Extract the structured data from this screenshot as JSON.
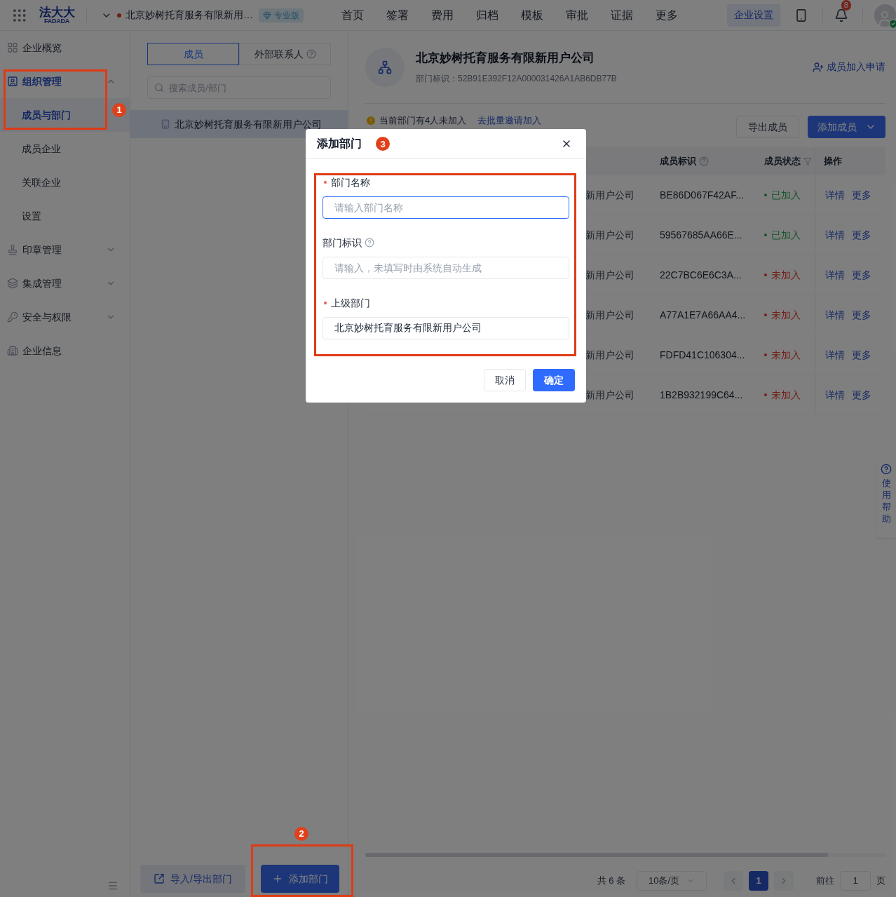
{
  "top_bar": {
    "logo_text": "法大大",
    "logo_subtext": "FADADA",
    "company": "北京妙树托育服务有限新用…",
    "edition": "专业版",
    "settings_button": "企业设置",
    "notification_count": "8",
    "nav": [
      {
        "label": "首页",
        "selected": false
      },
      {
        "label": "签署",
        "selected": false
      },
      {
        "label": "费用",
        "selected": false
      },
      {
        "label": "归档",
        "selected": false
      },
      {
        "label": "模板",
        "selected": false
      },
      {
        "label": "审批",
        "selected": false
      },
      {
        "label": "证据",
        "selected": false
      },
      {
        "label": "更多",
        "selected": false
      }
    ]
  },
  "sidebar": {
    "items": [
      {
        "label": "企业概览",
        "kind": "link",
        "selected": false
      },
      {
        "label": "组织管理",
        "kind": "group",
        "selected": true,
        "expanded": true,
        "children": [
          {
            "label": "成员与部门",
            "selected": true
          },
          {
            "label": "成员企业",
            "selected": false
          },
          {
            "label": "关联企业",
            "selected": false
          },
          {
            "label": "设置",
            "selected": false
          }
        ]
      },
      {
        "label": "印章管理",
        "kind": "group",
        "selected": false,
        "expanded": false
      },
      {
        "label": "集成管理",
        "kind": "group",
        "selected": false,
        "expanded": false
      },
      {
        "label": "安全与权限",
        "kind": "group",
        "selected": false,
        "expanded": false
      },
      {
        "label": "企业信息",
        "kind": "link",
        "selected": false
      }
    ]
  },
  "department_panel": {
    "tabs": [
      {
        "label": "成员",
        "selected": true,
        "help": false
      },
      {
        "label": "外部联系人",
        "selected": false,
        "help": true
      }
    ],
    "search": {
      "placeholder": "搜索成员/部门"
    },
    "tree": [
      {
        "label": "北京妙树托育服务有限新用户公司",
        "selected": true
      }
    ],
    "import_button": "导入/导出部门",
    "add_button": "添加部门"
  },
  "content": {
    "title": "北京妙树托育服务有限新用户公司",
    "id_label": "部门标识：",
    "id_value": "52B91E392F12A000031426A1AB6DB77B",
    "join_requests": "成员加入申请",
    "notice": "当前部门有4人未加入",
    "notice_link": "去批量邀请加入",
    "export_button": "导出成员",
    "add_member_button": "添加成员",
    "table": {
      "columns": [
        {
          "label": "成员标识"
        },
        {
          "label": "成员状态"
        },
        {
          "label": "操作"
        }
      ],
      "rows": [
        {
          "column_2": "新用户公司",
          "id": "BE86D067F42AF...",
          "status": "已加入",
          "kind": "joined",
          "actions": [
            "详情",
            "更多"
          ]
        },
        {
          "column_2": "新用户公司",
          "id": "59567685AA66E...",
          "status": "已加入",
          "kind": "joined",
          "actions": [
            "详情",
            "更多"
          ]
        },
        {
          "column_2": "新用户公司",
          "id": "22C7BC6E6C3A...",
          "status": "未加入",
          "kind": "not_joined",
          "actions": [
            "详情",
            "更多"
          ]
        },
        {
          "column_2": "新用户公司",
          "id": "A77A1E7A66AA4...",
          "status": "未加入",
          "kind": "not_joined",
          "actions": [
            "详情",
            "更多"
          ]
        },
        {
          "column_2": "新用户公司",
          "id": "FDFD41C106304...",
          "status": "未加入",
          "kind": "not_joined",
          "actions": [
            "详情",
            "更多"
          ]
        },
        {
          "column_2": "新用户公司",
          "id": "1B2B932199C64...",
          "status": "未加入",
          "kind": "not_joined",
          "actions": [
            "详情",
            "更多"
          ]
        }
      ]
    },
    "pagination": {
      "total": "共 6 条",
      "page_size": "10条/页",
      "pages": [
        {
          "label": "1",
          "selected": true
        }
      ],
      "goto_label": "前往",
      "goto_value": "1",
      "goto_suffix": "页"
    }
  },
  "help_float": {
    "label": "使用帮助"
  },
  "dialog": {
    "title": "添加部门",
    "fields": [
      {
        "label": "部门名称",
        "required": true,
        "help": false,
        "focused": true,
        "placeholder": "请输入部门名称"
      },
      {
        "label": "部门标识",
        "required": false,
        "help": true,
        "focused": false,
        "placeholder": "请输入，未填写时由系统自动生成"
      },
      {
        "label": "上级部门",
        "required": true,
        "help": false,
        "focused": false,
        "value": "北京妙树托育服务有限新用户公司"
      }
    ],
    "cancel_button": "取消",
    "confirm_button": "确定"
  },
  "annotations": [
    {
      "label": "1"
    },
    {
      "label": "2"
    },
    {
      "label": "3"
    }
  ]
}
